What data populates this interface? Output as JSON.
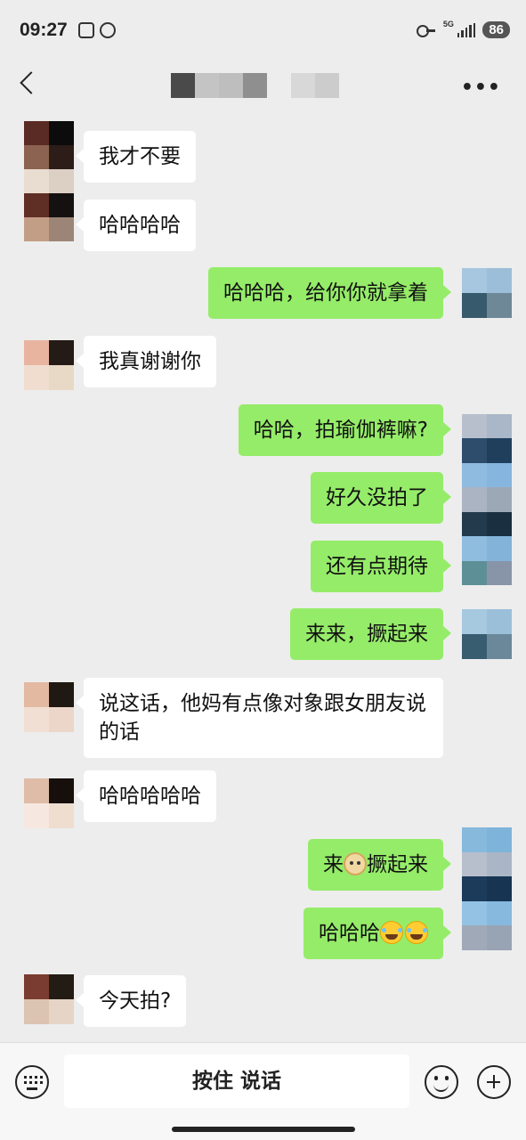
{
  "status_bar": {
    "time": "09:27",
    "network": "5G",
    "battery": "86"
  },
  "nav": {
    "title_blur_colors": [
      "#4a4a4a",
      "#c4c4c4",
      "#bebebe",
      "#8f8f8f",
      "#ededed",
      "#d8d8d8",
      "#cccccc"
    ],
    "back_icon": "chevron-left-icon",
    "more_icon": "more-dots-icon"
  },
  "messages": [
    {
      "side": "left",
      "text": "我才不要"
    },
    {
      "side": "left",
      "text": "哈哈哈哈"
    },
    {
      "side": "right",
      "text": "哈哈哈，给你你就拿着"
    },
    {
      "side": "left",
      "text": "我真谢谢你"
    },
    {
      "side": "right",
      "text": "哈哈，拍瑜伽裤嘛?"
    },
    {
      "side": "right",
      "text": "好久没拍了"
    },
    {
      "side": "right",
      "text": "还有点期待"
    },
    {
      "side": "right",
      "text": "来来，撅起来"
    },
    {
      "side": "left",
      "text": "说这话，他妈有点像对象跟女朋友说的话"
    },
    {
      "side": "left",
      "text": "哈哈哈哈哈"
    },
    {
      "side": "right",
      "text_before": "来",
      "emoji": "doge-emoji",
      "text_after": "撅起来"
    },
    {
      "side": "right",
      "text_before": "哈哈哈",
      "emoji": "laugh-cry-emoji",
      "emoji_count": 2
    },
    {
      "side": "left",
      "text": "今天拍?"
    }
  ],
  "input_bar": {
    "hold_to_talk": "按住 说话",
    "keyboard_icon": "keyboard-icon",
    "emoji_icon": "smile-icon",
    "plus_icon": "plus-icon"
  },
  "colors": {
    "background": "#ededed",
    "bubble_self": "#95ec69",
    "bubble_other": "#ffffff"
  }
}
